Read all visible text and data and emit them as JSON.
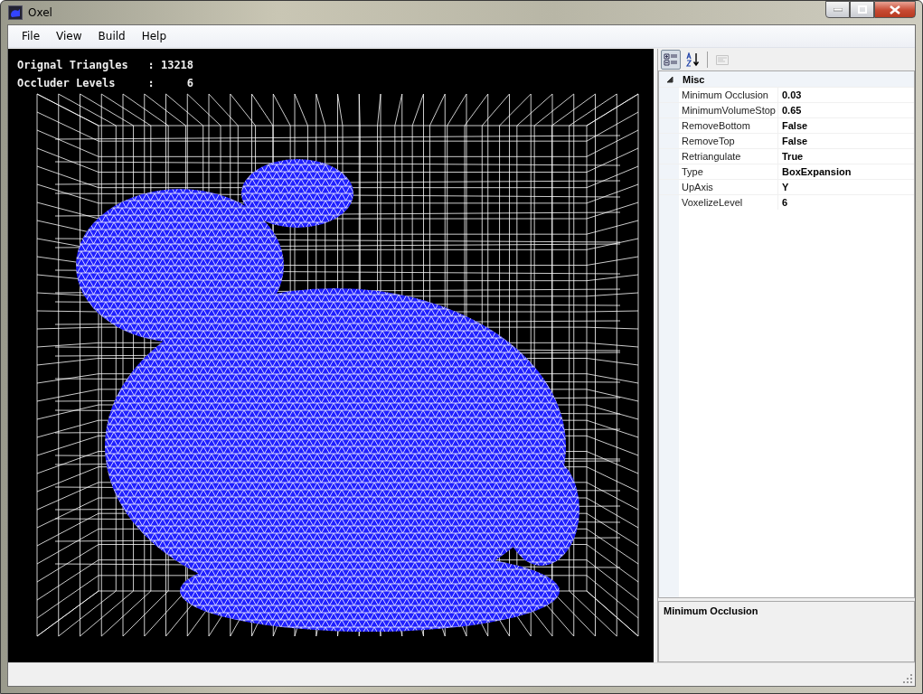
{
  "window": {
    "title": "Oxel"
  },
  "menu": [
    {
      "label": "File"
    },
    {
      "label": "View"
    },
    {
      "label": "Build"
    },
    {
      "label": "Help"
    }
  ],
  "viewport": {
    "overlay_lines": [
      "Orignal Triangles   : 13218",
      "Occluder Levels     :     6"
    ]
  },
  "property_toolbar": [
    {
      "kind": "categorized",
      "selected": true,
      "disabled": false
    },
    {
      "kind": "alphabetical",
      "selected": false,
      "disabled": false
    },
    {
      "kind": "pages",
      "selected": false,
      "disabled": true
    }
  ],
  "property_grid": {
    "category": {
      "label": "Misc",
      "expanded": true
    },
    "properties": [
      {
        "name": "Minimum Occlusion",
        "value": "0.03"
      },
      {
        "name": "MinimumVolumeStop",
        "value": "0.65"
      },
      {
        "name": "RemoveBottom",
        "value": "False"
      },
      {
        "name": "RemoveTop",
        "value": "False"
      },
      {
        "name": "Retriangulate",
        "value": "True"
      },
      {
        "name": "Type",
        "value": "BoxExpansion"
      },
      {
        "name": "UpAxis",
        "value": "Y"
      },
      {
        "name": "VoxelizeLevel",
        "value": "6"
      }
    ]
  },
  "description": {
    "title": "Minimum Occlusion"
  }
}
